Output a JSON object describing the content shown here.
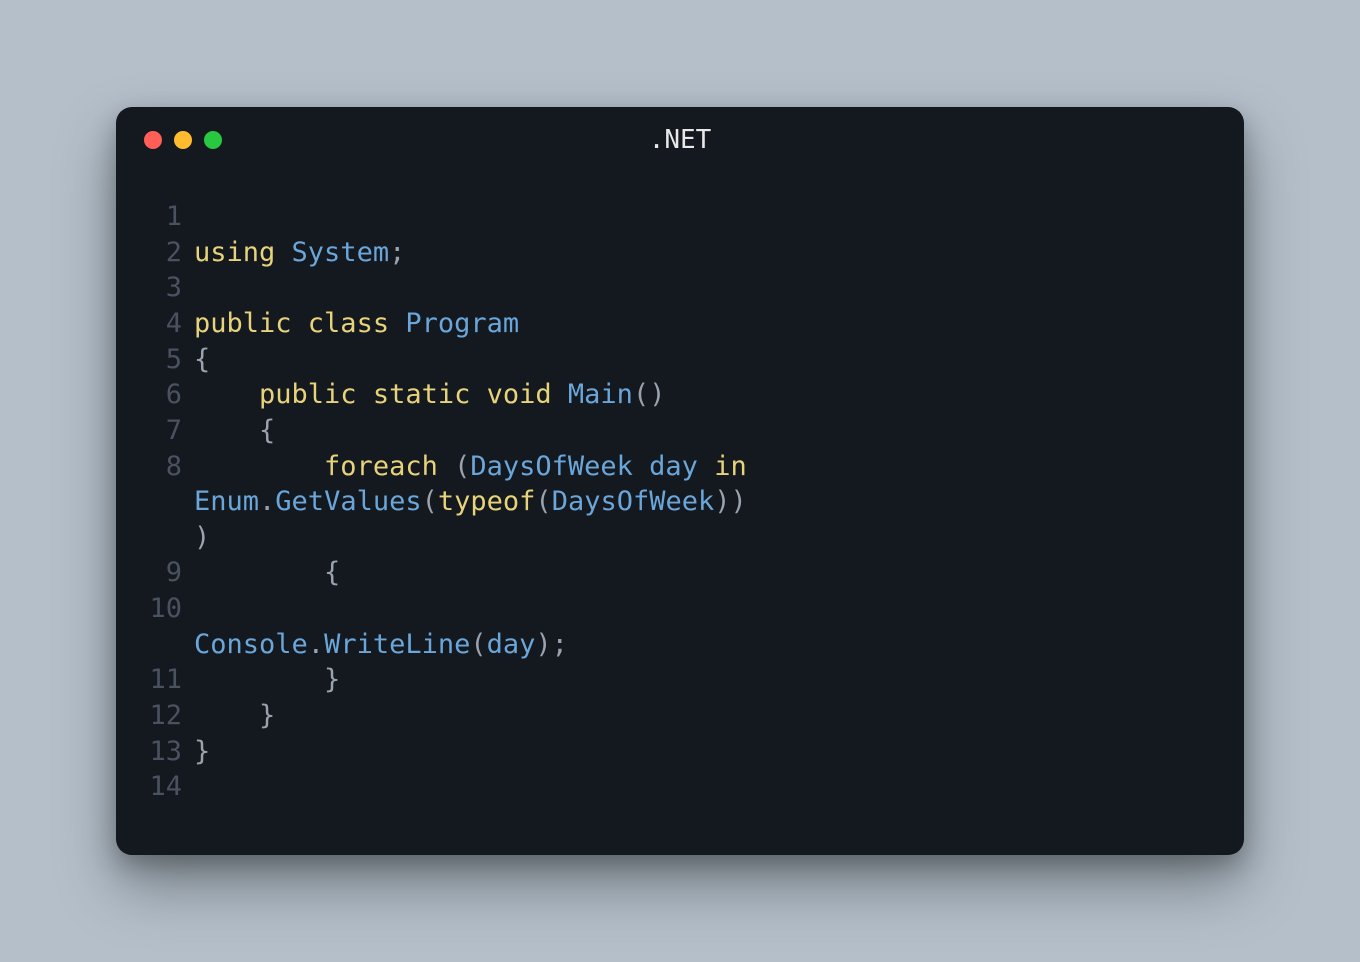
{
  "window": {
    "title": ".NET",
    "traffic": {
      "red": "#ff5f57",
      "yellow": "#febc2e",
      "green": "#28c840"
    }
  },
  "code": {
    "language": "csharp",
    "lines": [
      {
        "n": 1,
        "tokens": []
      },
      {
        "n": 2,
        "tokens": [
          {
            "t": "using ",
            "c": "kw"
          },
          {
            "t": "System",
            "c": "type"
          },
          {
            "t": ";",
            "c": "punc"
          }
        ]
      },
      {
        "n": 3,
        "tokens": []
      },
      {
        "n": 4,
        "tokens": [
          {
            "t": "public ",
            "c": "kw"
          },
          {
            "t": "class ",
            "c": "kw"
          },
          {
            "t": "Program",
            "c": "type"
          }
        ]
      },
      {
        "n": 5,
        "tokens": [
          {
            "t": "{",
            "c": "punc"
          }
        ]
      },
      {
        "n": 6,
        "tokens": [
          {
            "t": "    ",
            "c": "plain"
          },
          {
            "t": "public ",
            "c": "kw"
          },
          {
            "t": "static ",
            "c": "kw"
          },
          {
            "t": "void ",
            "c": "kw"
          },
          {
            "t": "Main",
            "c": "fn"
          },
          {
            "t": "()",
            "c": "punc"
          }
        ]
      },
      {
        "n": 7,
        "tokens": [
          {
            "t": "    {",
            "c": "punc"
          }
        ]
      },
      {
        "n": 8,
        "tokens": [
          {
            "t": "        ",
            "c": "plain"
          },
          {
            "t": "foreach ",
            "c": "kw"
          },
          {
            "t": "(",
            "c": "punc"
          },
          {
            "t": "DaysOfWeek ",
            "c": "type"
          },
          {
            "t": "day ",
            "c": "id"
          },
          {
            "t": "in ",
            "c": "kw"
          },
          {
            "t": "Enum",
            "c": "type"
          },
          {
            "t": ".",
            "c": "punc"
          },
          {
            "t": "GetValues",
            "c": "fn"
          },
          {
            "t": "(",
            "c": "punc"
          },
          {
            "t": "typeof",
            "c": "kw"
          },
          {
            "t": "(",
            "c": "punc"
          },
          {
            "t": "DaysOfWeek",
            "c": "type"
          },
          {
            "t": ")))",
            "c": "punc"
          }
        ]
      },
      {
        "n": 9,
        "tokens": [
          {
            "t": "        {",
            "c": "punc"
          }
        ]
      },
      {
        "n": 10,
        "tokens": [
          {
            "t": "            ",
            "c": "plain"
          },
          {
            "t": "Console",
            "c": "type"
          },
          {
            "t": ".",
            "c": "punc"
          },
          {
            "t": "WriteLine",
            "c": "fn"
          },
          {
            "t": "(",
            "c": "punc"
          },
          {
            "t": "day",
            "c": "id"
          },
          {
            "t": ");",
            "c": "punc"
          }
        ]
      },
      {
        "n": 11,
        "tokens": [
          {
            "t": "        }",
            "c": "punc"
          }
        ]
      },
      {
        "n": 12,
        "tokens": [
          {
            "t": "    }",
            "c": "punc"
          }
        ]
      },
      {
        "n": 13,
        "tokens": [
          {
            "t": "}",
            "c": "punc"
          }
        ]
      },
      {
        "n": 14,
        "tokens": []
      }
    ]
  }
}
